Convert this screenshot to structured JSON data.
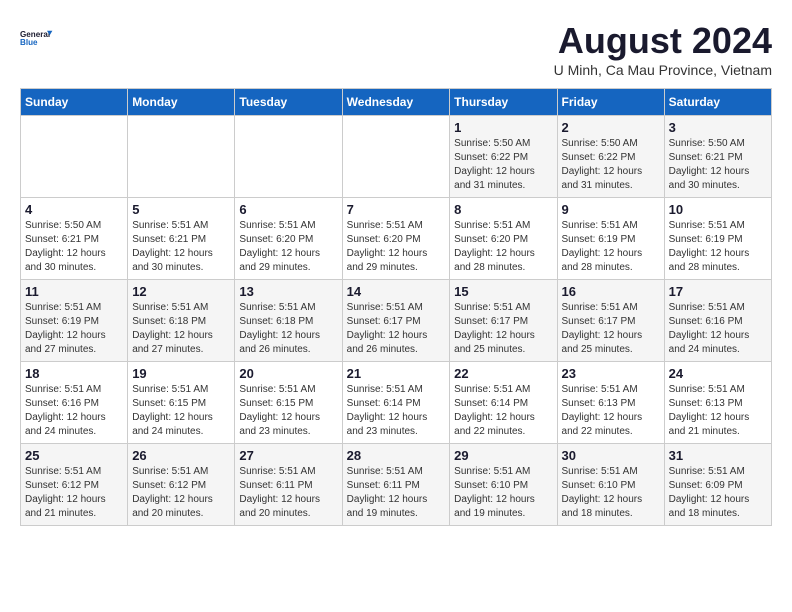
{
  "header": {
    "logo_line1": "General",
    "logo_line2": "Blue",
    "title": "August 2024",
    "subtitle": "U Minh, Ca Mau Province, Vietnam"
  },
  "calendar": {
    "days_of_week": [
      "Sunday",
      "Monday",
      "Tuesday",
      "Wednesday",
      "Thursday",
      "Friday",
      "Saturday"
    ],
    "weeks": [
      [
        {
          "day": "",
          "info": ""
        },
        {
          "day": "",
          "info": ""
        },
        {
          "day": "",
          "info": ""
        },
        {
          "day": "",
          "info": ""
        },
        {
          "day": "1",
          "info": "Sunrise: 5:50 AM\nSunset: 6:22 PM\nDaylight: 12 hours\nand 31 minutes."
        },
        {
          "day": "2",
          "info": "Sunrise: 5:50 AM\nSunset: 6:22 PM\nDaylight: 12 hours\nand 31 minutes."
        },
        {
          "day": "3",
          "info": "Sunrise: 5:50 AM\nSunset: 6:21 PM\nDaylight: 12 hours\nand 30 minutes."
        }
      ],
      [
        {
          "day": "4",
          "info": "Sunrise: 5:50 AM\nSunset: 6:21 PM\nDaylight: 12 hours\nand 30 minutes."
        },
        {
          "day": "5",
          "info": "Sunrise: 5:51 AM\nSunset: 6:21 PM\nDaylight: 12 hours\nand 30 minutes."
        },
        {
          "day": "6",
          "info": "Sunrise: 5:51 AM\nSunset: 6:20 PM\nDaylight: 12 hours\nand 29 minutes."
        },
        {
          "day": "7",
          "info": "Sunrise: 5:51 AM\nSunset: 6:20 PM\nDaylight: 12 hours\nand 29 minutes."
        },
        {
          "day": "8",
          "info": "Sunrise: 5:51 AM\nSunset: 6:20 PM\nDaylight: 12 hours\nand 28 minutes."
        },
        {
          "day": "9",
          "info": "Sunrise: 5:51 AM\nSunset: 6:19 PM\nDaylight: 12 hours\nand 28 minutes."
        },
        {
          "day": "10",
          "info": "Sunrise: 5:51 AM\nSunset: 6:19 PM\nDaylight: 12 hours\nand 28 minutes."
        }
      ],
      [
        {
          "day": "11",
          "info": "Sunrise: 5:51 AM\nSunset: 6:19 PM\nDaylight: 12 hours\nand 27 minutes."
        },
        {
          "day": "12",
          "info": "Sunrise: 5:51 AM\nSunset: 6:18 PM\nDaylight: 12 hours\nand 27 minutes."
        },
        {
          "day": "13",
          "info": "Sunrise: 5:51 AM\nSunset: 6:18 PM\nDaylight: 12 hours\nand 26 minutes."
        },
        {
          "day": "14",
          "info": "Sunrise: 5:51 AM\nSunset: 6:17 PM\nDaylight: 12 hours\nand 26 minutes."
        },
        {
          "day": "15",
          "info": "Sunrise: 5:51 AM\nSunset: 6:17 PM\nDaylight: 12 hours\nand 25 minutes."
        },
        {
          "day": "16",
          "info": "Sunrise: 5:51 AM\nSunset: 6:17 PM\nDaylight: 12 hours\nand 25 minutes."
        },
        {
          "day": "17",
          "info": "Sunrise: 5:51 AM\nSunset: 6:16 PM\nDaylight: 12 hours\nand 24 minutes."
        }
      ],
      [
        {
          "day": "18",
          "info": "Sunrise: 5:51 AM\nSunset: 6:16 PM\nDaylight: 12 hours\nand 24 minutes."
        },
        {
          "day": "19",
          "info": "Sunrise: 5:51 AM\nSunset: 6:15 PM\nDaylight: 12 hours\nand 24 minutes."
        },
        {
          "day": "20",
          "info": "Sunrise: 5:51 AM\nSunset: 6:15 PM\nDaylight: 12 hours\nand 23 minutes."
        },
        {
          "day": "21",
          "info": "Sunrise: 5:51 AM\nSunset: 6:14 PM\nDaylight: 12 hours\nand 23 minutes."
        },
        {
          "day": "22",
          "info": "Sunrise: 5:51 AM\nSunset: 6:14 PM\nDaylight: 12 hours\nand 22 minutes."
        },
        {
          "day": "23",
          "info": "Sunrise: 5:51 AM\nSunset: 6:13 PM\nDaylight: 12 hours\nand 22 minutes."
        },
        {
          "day": "24",
          "info": "Sunrise: 5:51 AM\nSunset: 6:13 PM\nDaylight: 12 hours\nand 21 minutes."
        }
      ],
      [
        {
          "day": "25",
          "info": "Sunrise: 5:51 AM\nSunset: 6:12 PM\nDaylight: 12 hours\nand 21 minutes."
        },
        {
          "day": "26",
          "info": "Sunrise: 5:51 AM\nSunset: 6:12 PM\nDaylight: 12 hours\nand 20 minutes."
        },
        {
          "day": "27",
          "info": "Sunrise: 5:51 AM\nSunset: 6:11 PM\nDaylight: 12 hours\nand 20 minutes."
        },
        {
          "day": "28",
          "info": "Sunrise: 5:51 AM\nSunset: 6:11 PM\nDaylight: 12 hours\nand 19 minutes."
        },
        {
          "day": "29",
          "info": "Sunrise: 5:51 AM\nSunset: 6:10 PM\nDaylight: 12 hours\nand 19 minutes."
        },
        {
          "day": "30",
          "info": "Sunrise: 5:51 AM\nSunset: 6:10 PM\nDaylight: 12 hours\nand 18 minutes."
        },
        {
          "day": "31",
          "info": "Sunrise: 5:51 AM\nSunset: 6:09 PM\nDaylight: 12 hours\nand 18 minutes."
        }
      ]
    ]
  }
}
